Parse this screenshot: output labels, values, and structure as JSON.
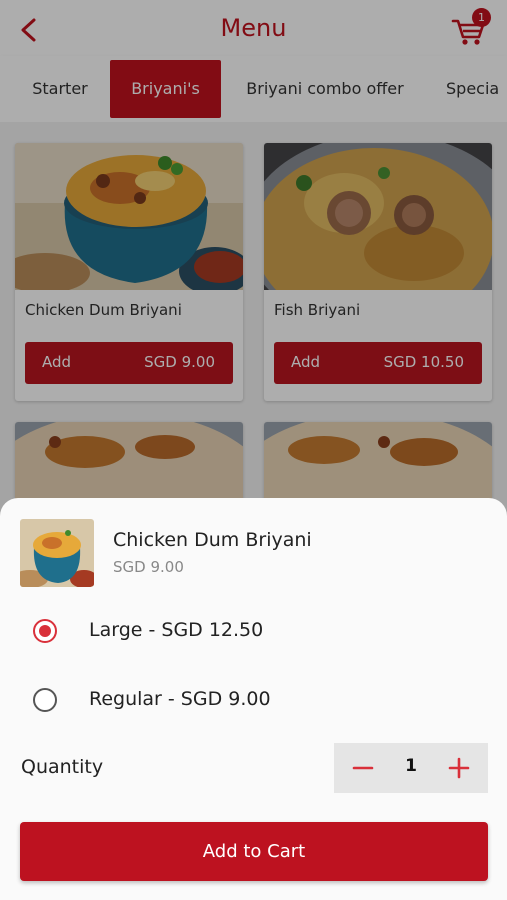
{
  "header": {
    "title": "Menu",
    "back_icon": "chevron-left-icon",
    "cart_icon": "cart-icon",
    "cart_count": "1",
    "accent_color": "#c0121e"
  },
  "tabs": [
    {
      "label": "Starter",
      "active": false
    },
    {
      "label": "Briyani's",
      "active": true
    },
    {
      "label": "Briyani combo offer",
      "active": false
    },
    {
      "label": "Specia",
      "active": false
    }
  ],
  "menu_items": [
    {
      "name": "Chicken Dum Briyani",
      "add_label": "Add",
      "price": "SGD 9.00"
    },
    {
      "name": "Fish Briyani",
      "add_label": "Add",
      "price": "SGD 10.50"
    },
    {
      "name": "",
      "add_label": "",
      "price": ""
    },
    {
      "name": "",
      "add_label": "",
      "price": ""
    }
  ],
  "sheet": {
    "item_name": "Chicken Dum Briyani",
    "item_price": "SGD 9.00",
    "options": [
      {
        "label": "Large - SGD 12.50",
        "selected": true
      },
      {
        "label": "Regular - SGD 9.00",
        "selected": false
      }
    ],
    "quantity_label": "Quantity",
    "quantity": "1",
    "add_to_cart_label": "Add to Cart"
  }
}
